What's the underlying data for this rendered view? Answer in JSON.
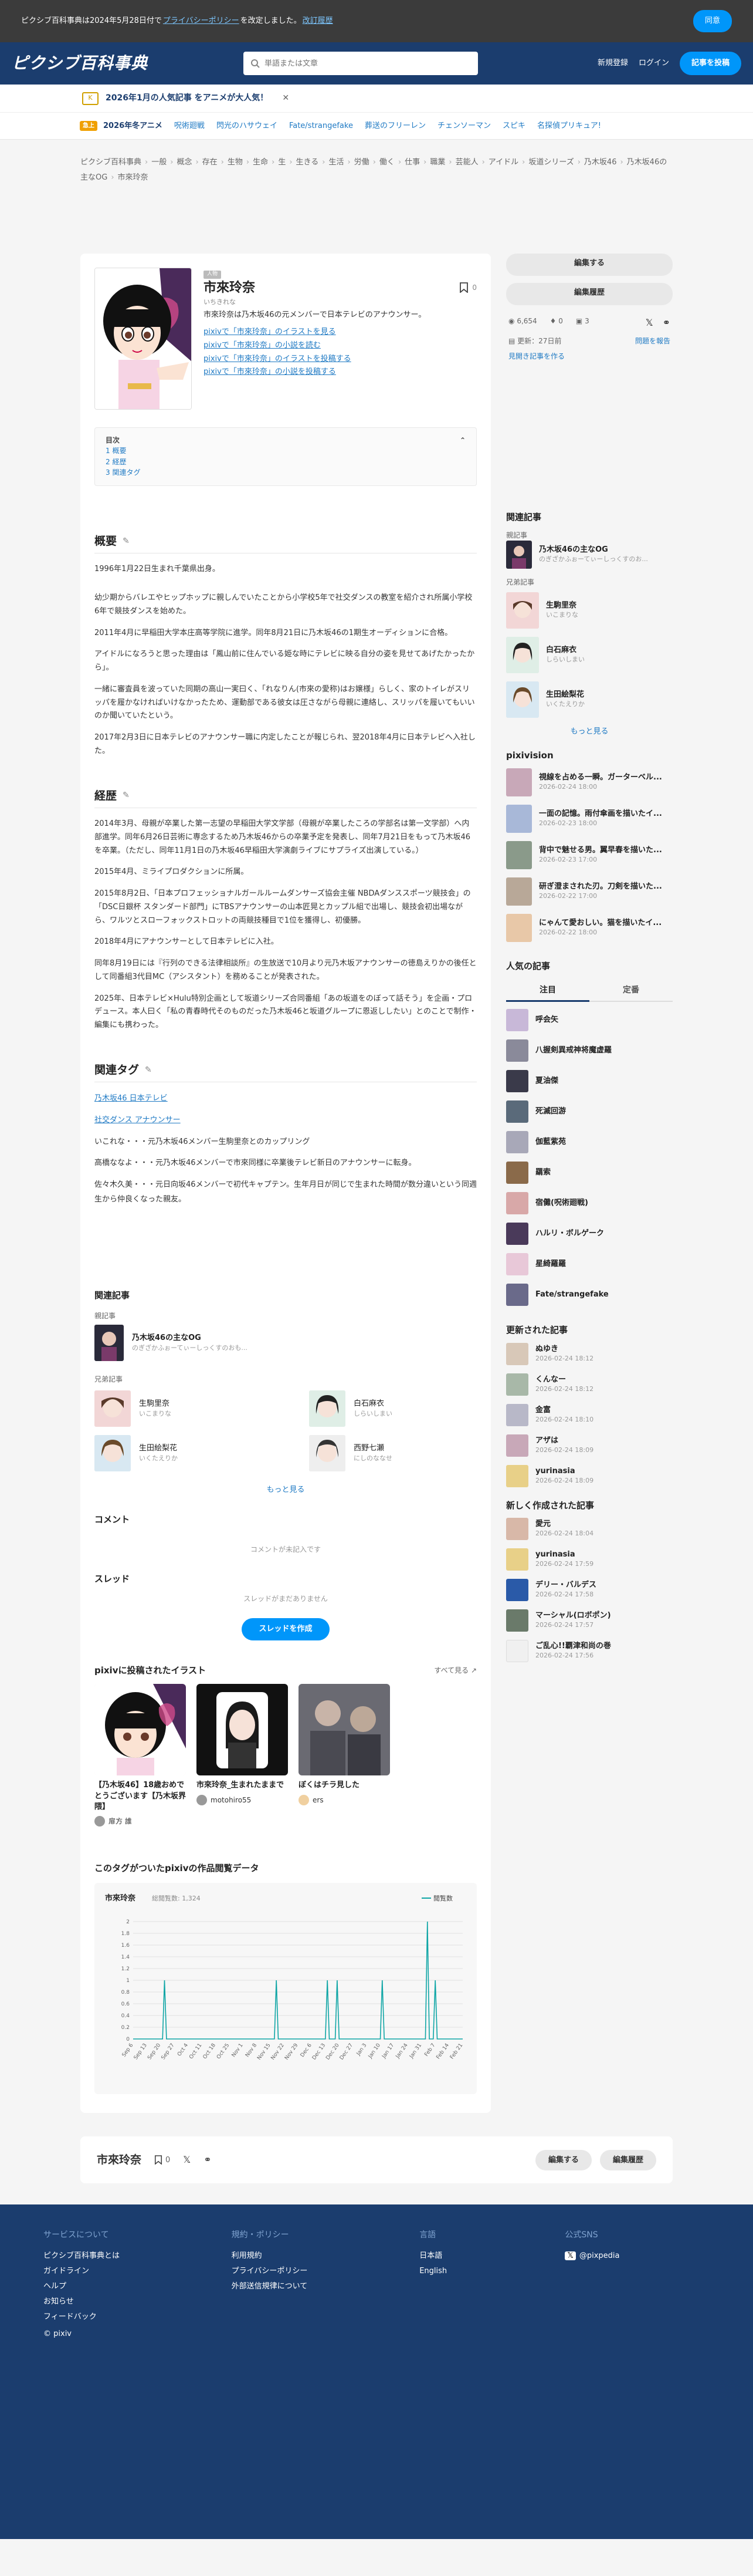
{
  "notice": {
    "pre": "ピクシブ百科事典は2024年5月28日付で",
    "link1": "プライバシーポリシー",
    "mid": "を改定しました。",
    "link2": "改訂履歴",
    "button": "同意"
  },
  "header": {
    "logo": "ピクシブ百科事典",
    "search_placeholder": "単語または文章",
    "signup": "新規登録",
    "login": "ログイン",
    "create": "記事を投稿"
  },
  "ad": {
    "badge": "K",
    "text": "2026年1月の人気記事 をアニメが大人気！",
    "close": "✕"
  },
  "tags": {
    "label": "急上",
    "items": [
      "2026年冬アニメ",
      "呪術廻戦",
      "閃光のハサウェイ",
      "Fate/strangefake",
      "葬送のフリーレン",
      "チェンソーマン",
      "スピキ",
      "名探偵プリキュア!"
    ]
  },
  "breadcrumb": [
    "ピクシブ百科事典",
    "一般",
    "概念",
    "存在",
    "生物",
    "生命",
    "生",
    "生きる",
    "生活",
    "労働",
    "働く",
    "仕事",
    "職業",
    "芸能人",
    "アイドル",
    "坂道シリーズ",
    "乃木坂46",
    "乃木坂46の主なOG",
    "市來玲奈"
  ],
  "article": {
    "badge": "人物",
    "title": "市來玲奈",
    "reading": "いちきれな",
    "desc": "市來玲奈は乃木坂46の元メンバーで日本テレビのアナウンサー。",
    "bookmark_count": "0",
    "links": [
      "pixivで「市來玲奈」のイラストを見る",
      "pixivで「市來玲奈」の小説を読む",
      "pixivで「市來玲奈」のイラストを投稿する",
      "pixivで「市來玲奈」の小説を投稿する"
    ],
    "toc_title": "目次",
    "toc": [
      "1 概要",
      "2 経歴",
      "3 関連タグ"
    ],
    "s1": "概要",
    "p1": "1996年1月22日生まれ千葉県出身。",
    "p2": "幼少期からバレエやヒップホップに親しんでいたことから小学校5年で社交ダンスの教室を紹介され所属小学校6年で競技ダンスを始めた。",
    "p3": "2011年4月に早稲田大学本庄高等学院に進学。同年8月21日に乃木坂46の1期生オーディションに合格。",
    "p4": "アイドルになろうと思った理由は「鳳山前に住んでいる姫な時にテレビに映る自分の姿を見せてあげたかったから」。",
    "p5": "一緒に審査員を波っていた同期の高山一実曰く、「れなりん(市來の愛称)はお嬢様」らしく、家のトイレがスリッパを履かなければいけなかったため、運動部である彼女は圧さながら母親に連絡し、スリッパを履いてもいいのか聞いていたという。",
    "p6": "2017年2月3日に日本テレビのアナウンサー職に内定したことが報じられ、翌2018年4月に日本テレビへ入社した。",
    "s2": "経歴",
    "p7": "2014年3月、母親が卒業した第一志望の早稲田大学文学部（母親が卒業したころの学部名は第一文学部）へ内部進学。同年6月26日芸術に専念するため乃木坂46からの卒業予定を発表し、同年7月21日をもって乃木坂46を卒業。（ただし、同年11月1日の乃木坂46早稲田大学演劇ライブにサプライズ出演している。）",
    "p8": "2015年4月、ミライプロダクションに所属。",
    "p9": "2015年8月2日、「日本プロフェッショナルガールルームダンサーズ協会主催 NBDAダンススポーツ競技会」の「DSC日銀杯 スタンダード部門」にTBSアナウンサーの山本匠晃とカップル組で出場し、競技会初出場ながら、ワルツとスローフォックストロットの両競技種目で1位を獲得し、初優勝。",
    "p10": "2018年4月にアナウンサーとして日本テレビに入社。",
    "p11": "同年8月19日には『行列のできる法律相談所』の生放送で10月より元乃木坂アナウンサーの徳島えりかの後任として同番組3代目MC（アシスタント）を務めることが発表された。",
    "p12": "2025年、日本テレビ×Hulu特別企画として坂道シリーズ合同番組「あの坂道をのぼって話そう」を企画・プロデュース。本人曰く「私の青春時代そのものだった乃木坂46と坂道グループに恩返ししたい」とのことで制作・編集にも携わった。",
    "s3": "関連タグ",
    "rt1": "乃木坂46 日本テレビ",
    "rt2": "社交ダンス アナウンサー",
    "rt3": "いこれな・・・元乃木坂46メンバー生駒里奈とのカップリング",
    "rt4": "高橋ななよ・・・元乃木坂46メンバーで市來同様に卒業後テレビ新日のアナウンサーに転身。",
    "rt5": "佐々木久美・・・元日向坂46メンバーで初代キャプテン。生年月日が同じで生まれた時間が数分違いという同週生から仲良くなった親友。"
  },
  "related": {
    "title": "関連記事",
    "parent_label": "親記事",
    "parent_name": "乃木坂46の主なOG",
    "parent_sub": "のぎざかふぉーてぃーしっくすのおも...",
    "sibling_label": "兄弟記事",
    "siblings": [
      {
        "name": "生駒里奈",
        "sub": "いこまりな"
      },
      {
        "name": "白石麻衣",
        "sub": "しらいしまい"
      },
      {
        "name": "生田絵梨花",
        "sub": "いくたえりか"
      },
      {
        "name": "西野七瀬",
        "sub": "にしのななせ"
      }
    ],
    "more": "もっと見る"
  },
  "comment": {
    "title": "コメント",
    "empty": "コメントが未記入です"
  },
  "thread": {
    "title": "スレッド",
    "empty": "スレッドがまだありません",
    "button": "スレッドを作成"
  },
  "illust": {
    "title": "pixivに投稿されたイラスト",
    "all": "すべて見る",
    "items": [
      {
        "title": "【乃木坂46】18歳おめでとうございます【乃木坂界隈】",
        "user": "扉方 誰"
      },
      {
        "title": "市來玲奈_生まれたままで",
        "user": "motohiro55"
      },
      {
        "title": "ぼくはチラ見した",
        "user": "ers"
      }
    ]
  },
  "chart_data": {
    "type": "line",
    "title": "市來玲奈",
    "subtitle": "総閲覧数: 1,324",
    "series": [
      {
        "name": "閲覧数",
        "values": [
          0,
          0,
          0,
          0,
          0,
          0,
          0,
          0,
          0,
          0,
          0,
          0,
          0,
          0,
          0,
          0,
          1,
          0,
          0,
          0,
          0,
          0,
          0,
          0,
          0,
          0,
          0,
          0,
          0,
          0,
          0,
          0,
          0,
          0,
          0,
          0,
          0,
          0,
          0,
          0,
          0,
          0,
          0,
          0,
          0,
          0,
          0,
          0,
          0,
          0,
          0,
          0,
          0,
          0,
          0,
          0,
          0,
          0,
          0,
          0,
          0,
          0,
          0,
          0,
          0,
          0,
          0,
          0,
          0,
          0,
          0,
          0,
          0,
          1,
          0,
          0,
          0,
          0,
          0,
          0,
          0,
          0,
          0,
          0,
          0,
          0,
          0,
          0,
          0,
          0,
          0,
          0,
          0,
          0,
          0,
          0,
          0,
          0,
          0,
          1,
          0,
          0,
          0,
          0,
          1,
          0,
          0,
          0,
          0,
          0,
          0,
          0,
          0,
          0,
          0,
          0,
          0,
          0,
          0,
          0,
          0,
          0,
          0,
          0,
          0,
          0,
          0,
          1,
          0,
          0,
          0,
          0,
          0,
          0,
          0,
          0,
          0,
          0,
          0,
          0,
          0,
          0,
          0,
          0,
          0,
          0,
          0,
          0,
          0,
          0,
          2,
          0,
          0,
          0,
          1,
          0,
          0,
          0,
          0,
          0,
          0,
          0,
          0,
          0,
          0,
          0,
          0,
          0,
          0
        ]
      }
    ],
    "x_labels": [
      "Sep 6",
      "Sep 13",
      "Sep 20",
      "Sep 27",
      "Oct 4",
      "Oct 11",
      "Oct 18",
      "Oct 25",
      "Nov 1",
      "Nov 8",
      "Nov 15",
      "Nov 22",
      "Nov 29",
      "Dec 6",
      "Dec 13",
      "Dec 20",
      "Dec 27",
      "Jan 3",
      "Jan 10",
      "Jan 17",
      "Jan 24",
      "Jan 31",
      "Feb 7",
      "Feb 14",
      "Feb 21"
    ],
    "ylim": [
      0,
      2
    ],
    "y_ticks": [
      "0",
      "0.2",
      "0.4",
      "0.6",
      "0.8",
      "1",
      "1.2",
      "1.4",
      "1.6",
      "1.8",
      "2"
    ],
    "line_color": "#0ea5a5",
    "legend_position": "top-right"
  },
  "side": {
    "edit": "編集する",
    "history": "編集履歴",
    "views": "6,654",
    "bookmarks": "0",
    "comments": "3",
    "updated": "更新：27日前",
    "report": "問題を報告",
    "ad_link": "見開き記事を作る",
    "related_title": "関連記事",
    "parent_label": "親記事",
    "parent_name": "乃木坂46の主なOG",
    "parent_sub": "のぎざかふぉーてぃーしっくすのお...",
    "sibling_label": "兄弟記事",
    "siblings": [
      {
        "name": "生駒里奈",
        "sub": "いこまりな"
      },
      {
        "name": "白石麻衣",
        "sub": "しらいしまい"
      },
      {
        "name": "生田絵梨花",
        "sub": "いくたえりか"
      }
    ],
    "more": "もっと見る",
    "pixivision_title": "pixivision",
    "pixivision": [
      {
        "name": "視線を占める一瞬。ガーターベル...",
        "date": "2026-02-24 18:00"
      },
      {
        "name": "一面の記憶。雨付傘画を描いたイ...",
        "date": "2026-02-23 18:00"
      },
      {
        "name": "背中で魅せる男。翼早春を描いた...",
        "date": "2026-02-23 17:00"
      },
      {
        "name": "研ぎ澄まされた刃。刀剣を描いた...",
        "date": "2026-02-22 17:00"
      },
      {
        "name": "にゃんて愛おしい。猫を描いたイ...",
        "date": "2026-02-22 18:00"
      }
    ],
    "popular_title": "人気の記事",
    "tab_now": "注目",
    "tab_fixed": "定番",
    "popular": [
      "呼会矢",
      "八握剣異戒神将魔虚羅",
      "夏油傑",
      "死滅回游",
      "伽藍紫苑",
      "羂索",
      "宿儺(呪術廻戦)",
      "ハルリ・ボルゲーク",
      "星綺羅羅",
      "Fate/strangefake"
    ],
    "updated_title": "更新された記事",
    "updated_list": [
      {
        "name": "ぬゆき",
        "date": "2026-02-24 18:12"
      },
      {
        "name": "くんなー",
        "date": "2026-02-24 18:12"
      },
      {
        "name": "金富",
        "date": "2026-02-24 18:10"
      },
      {
        "name": "アザは",
        "date": "2026-02-24 18:09"
      },
      {
        "name": "yurinasia",
        "date": "2026-02-24 18:09"
      }
    ],
    "new_title": "新しく作成された記事",
    "new_list": [
      {
        "name": "愛元",
        "date": "2026-02-24 18:04"
      },
      {
        "name": "yurinasia",
        "date": "2026-02-24 17:59"
      },
      {
        "name": "デリー・バルデス",
        "date": "2026-02-24 17:58"
      },
      {
        "name": "マーシャル(ロボポン)",
        "date": "2026-02-24 17:57"
      },
      {
        "name": "ご乱心!!覇津和尚の巻",
        "date": "2026-02-24 17:56"
      }
    ]
  },
  "bottombar": {
    "title": "市來玲奈",
    "count": "0",
    "edit": "編集する",
    "history": "編集履歴"
  },
  "footer": {
    "c1_title": "サービスについて",
    "c1": [
      "ピクシブ百科事典とは",
      "ガイドライン",
      "ヘルプ",
      "お知らせ",
      "フィードバック"
    ],
    "copy": "© pixiv",
    "c2_title": "規約・ポリシー",
    "c2": [
      "利用規約",
      "プライバシーポリシー",
      "外部送信規律について"
    ],
    "c3_title": "言語",
    "c3": [
      "日本語",
      "English"
    ],
    "c4_title": "公式SNS",
    "c4": [
      "@pixpedia"
    ]
  }
}
